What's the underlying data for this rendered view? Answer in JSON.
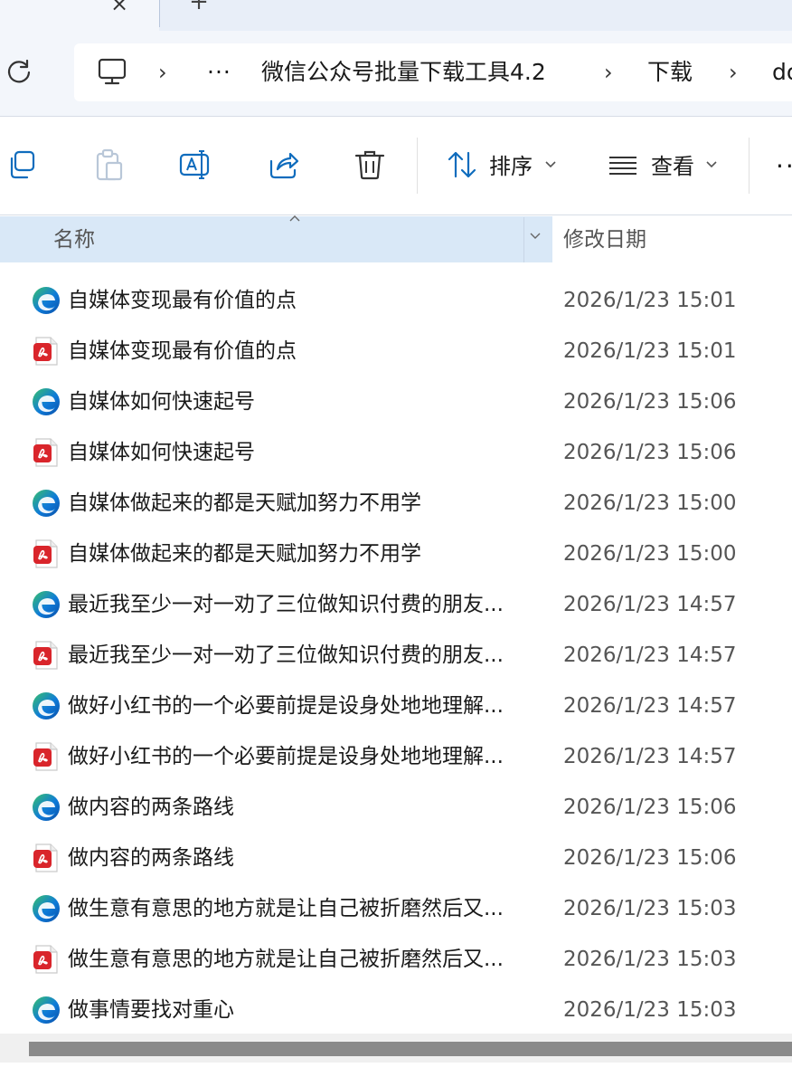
{
  "window": {
    "tab_close_glyph": "×",
    "tab_new_glyph": "+"
  },
  "address": {
    "refresh_icon": "refresh-icon",
    "computer_icon": "computer-icon",
    "sep1": "›",
    "ellipsis": "···",
    "crumb1": "微信公众号批量下载工具4.2",
    "sep2": "›",
    "crumb2": "下载",
    "sep3": "›",
    "crumb3": "do"
  },
  "toolbar": {
    "copy_icon": "copy-icon",
    "paste_icon": "paste-icon",
    "rename_icon": "rename-icon",
    "share_icon": "share-icon",
    "delete_icon": "trash-icon",
    "sort_label": "排序",
    "view_label": "查看",
    "more_glyph": "··"
  },
  "columns": {
    "name": "名称",
    "modified": "修改日期"
  },
  "colors": {
    "edge_blue": "#0f7bd8",
    "edge_green": "#39c26b",
    "pdf_red": "#d9252b",
    "header_bg": "#d9e8f7"
  },
  "files": [
    {
      "type": "edge",
      "icon": "edge-html-icon",
      "name": "自媒体变现最有价值的点",
      "date": "2026/1/23 15:01"
    },
    {
      "type": "pdf",
      "icon": "pdf-icon",
      "name": "自媒体变现最有价值的点",
      "date": "2026/1/23 15:01"
    },
    {
      "type": "edge",
      "icon": "edge-html-icon",
      "name": "自媒体如何快速起号",
      "date": "2026/1/23 15:06"
    },
    {
      "type": "pdf",
      "icon": "pdf-icon",
      "name": "自媒体如何快速起号",
      "date": "2026/1/23 15:06"
    },
    {
      "type": "edge",
      "icon": "edge-html-icon",
      "name": "自媒体做起来的都是天赋加努力不用学",
      "date": "2026/1/23 15:00"
    },
    {
      "type": "pdf",
      "icon": "pdf-icon",
      "name": "自媒体做起来的都是天赋加努力不用学",
      "date": "2026/1/23 15:00"
    },
    {
      "type": "edge",
      "icon": "edge-html-icon",
      "name": "最近我至少一对一劝了三位做知识付费的朋友...",
      "date": "2026/1/23 14:57"
    },
    {
      "type": "pdf",
      "icon": "pdf-icon",
      "name": "最近我至少一对一劝了三位做知识付费的朋友...",
      "date": "2026/1/23 14:57"
    },
    {
      "type": "edge",
      "icon": "edge-html-icon",
      "name": "做好小红书的一个必要前提是设身处地地理解...",
      "date": "2026/1/23 14:57"
    },
    {
      "type": "pdf",
      "icon": "pdf-icon",
      "name": "做好小红书的一个必要前提是设身处地地理解...",
      "date": "2026/1/23 14:57"
    },
    {
      "type": "edge",
      "icon": "edge-html-icon",
      "name": "做内容的两条路线",
      "date": "2026/1/23 15:06"
    },
    {
      "type": "pdf",
      "icon": "pdf-icon",
      "name": "做内容的两条路线",
      "date": "2026/1/23 15:06"
    },
    {
      "type": "edge",
      "icon": "edge-html-icon",
      "name": "做生意有意思的地方就是让自己被折磨然后又...",
      "date": "2026/1/23 15:03"
    },
    {
      "type": "pdf",
      "icon": "pdf-icon",
      "name": "做生意有意思的地方就是让自己被折磨然后又...",
      "date": "2026/1/23 15:03"
    },
    {
      "type": "edge",
      "icon": "edge-html-icon",
      "name": "做事情要找对重心",
      "date": "2026/1/23 15:03"
    }
  ]
}
